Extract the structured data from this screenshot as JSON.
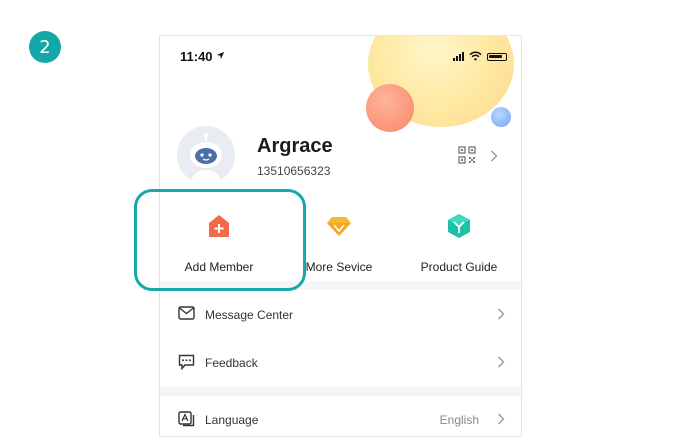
{
  "step": {
    "number": "2",
    "color": "#14a8a8"
  },
  "status_bar": {
    "time": "11:40",
    "icons": [
      "location-arrow-icon",
      "signal-icon",
      "wifi-icon",
      "battery-icon"
    ]
  },
  "profile": {
    "name": "Argrace",
    "phone": "13510656323"
  },
  "features": [
    {
      "label": "Add Member",
      "icon": "add-member-icon",
      "color": "#f26a4b"
    },
    {
      "label": "More Sevice",
      "icon": "diamond-icon",
      "color": "#f7b731"
    },
    {
      "label": "Product Guide",
      "icon": "cube-icon",
      "color": "#1cc2a5"
    }
  ],
  "menu": [
    {
      "label": "Message Center",
      "icon": "envelope-icon",
      "value": ""
    },
    {
      "label": "Feedback",
      "icon": "chat-icon",
      "value": ""
    },
    {
      "label": "Language",
      "icon": "language-icon",
      "value": "English"
    }
  ],
  "highlight": {
    "target": "Add Member",
    "color": "#17a9a9"
  }
}
